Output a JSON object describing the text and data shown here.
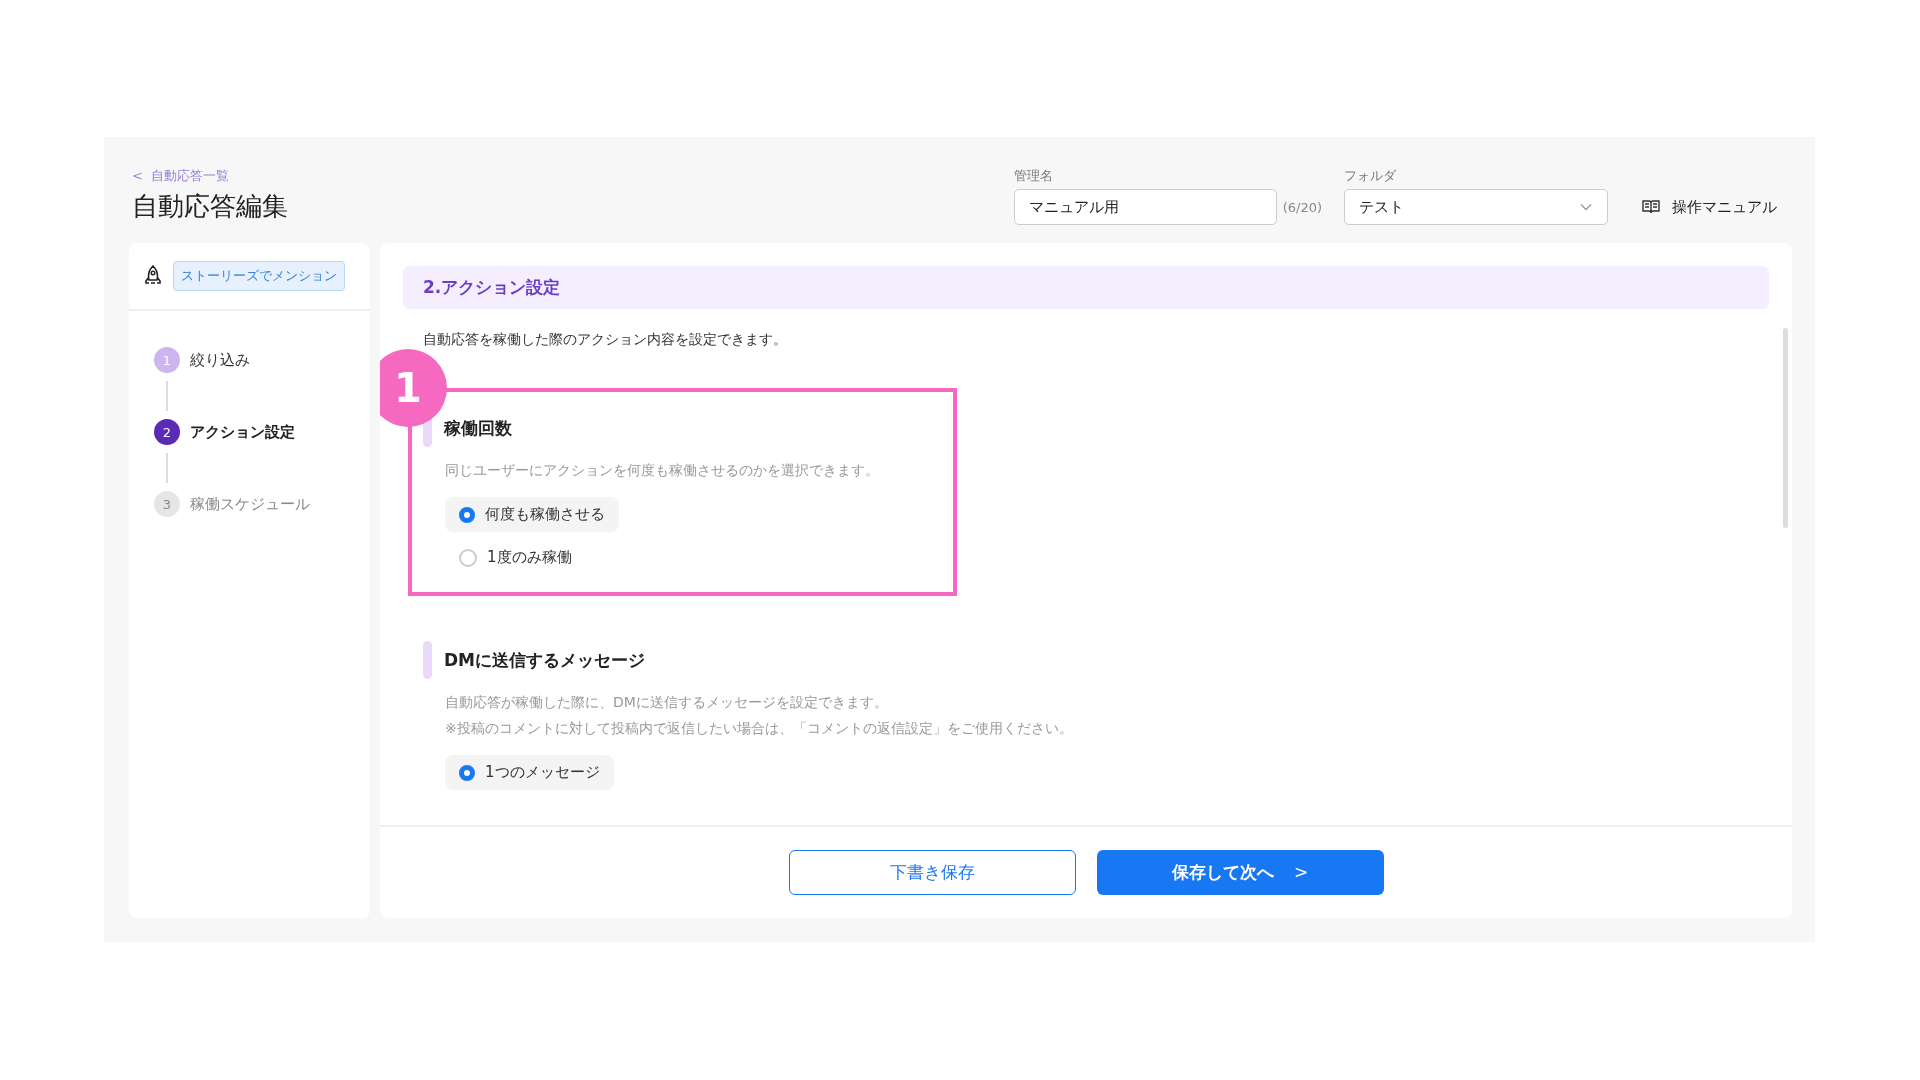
{
  "breadcrumb": {
    "icon": "<",
    "label": "自動応答一覧"
  },
  "page_title": "自動応答編集",
  "name_field": {
    "label": "管理名",
    "value": "マニュアル用",
    "counter": "(6/20)"
  },
  "folder_select": {
    "label": "フォルダ",
    "value": "テスト"
  },
  "manual_link": {
    "label": "操作マニュアル"
  },
  "sidebar": {
    "trigger_tag": "ストーリーズでメンション",
    "steps": [
      {
        "number": "1",
        "label": "絞り込み",
        "done": true,
        "selected": false
      },
      {
        "number": "2",
        "label": "アクション設定",
        "done": false,
        "selected": true
      },
      {
        "number": "3",
        "label": "稼働スケジュール",
        "done": false,
        "selected": false
      }
    ]
  },
  "section_header": "2.アクション設定",
  "section_description": "自動応答を稼働した際のアクション内容を設定できます。",
  "groups": [
    {
      "title": "稼働回数",
      "description": [
        "同じユーザーにアクションを何度も稼働させるのかを選択できます。"
      ],
      "annotation": "1",
      "options": [
        {
          "label": "何度も稼働させる",
          "selected": true
        },
        {
          "label": "1度のみ稼働",
          "selected": false
        }
      ]
    },
    {
      "title": "DMに送信するメッセージ",
      "description": [
        "自動応答が稼働した際に、DMに送信するメッセージを設定できます。",
        "※投稿のコメントに対して投稿内で返信したい場合は、「コメントの返信設定」をご使用ください。"
      ],
      "options": [
        {
          "label": "1つのメッセージ",
          "selected": true
        }
      ]
    }
  ],
  "buttons": {
    "draft": "下書き保存",
    "next": "保存して次へ",
    "next_icon": ">"
  }
}
